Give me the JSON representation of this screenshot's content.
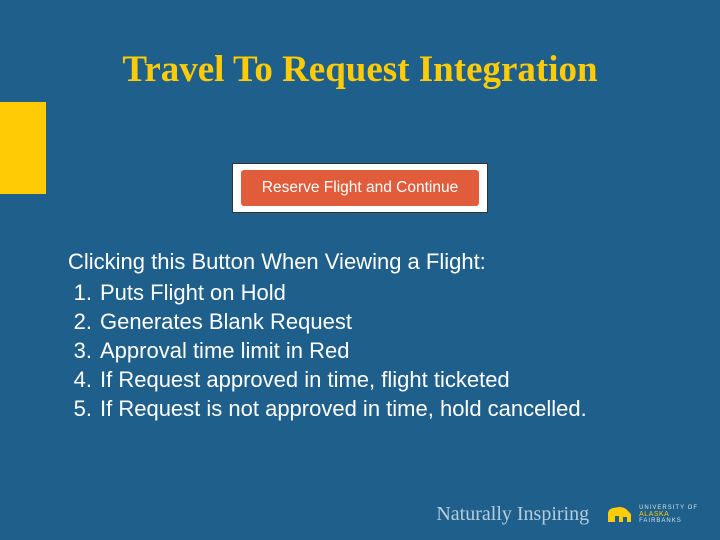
{
  "title": "Travel To Request Integration",
  "button": {
    "label": "Reserve Flight and Continue"
  },
  "content": {
    "lead": "Clicking this Button When Viewing a Flight:",
    "items": [
      "Puts Flight on Hold",
      "Generates Blank Request",
      "Approval time limit in Red",
      "If Request approved in time, flight ticketed",
      "If Request is not approved in time, hold cancelled."
    ]
  },
  "footer": {
    "tagline": "Naturally Inspiring",
    "logo_line1": "UNIVERSITY OF",
    "logo_line2": "ALASKA",
    "logo_line3": "FAIRBANKS"
  }
}
